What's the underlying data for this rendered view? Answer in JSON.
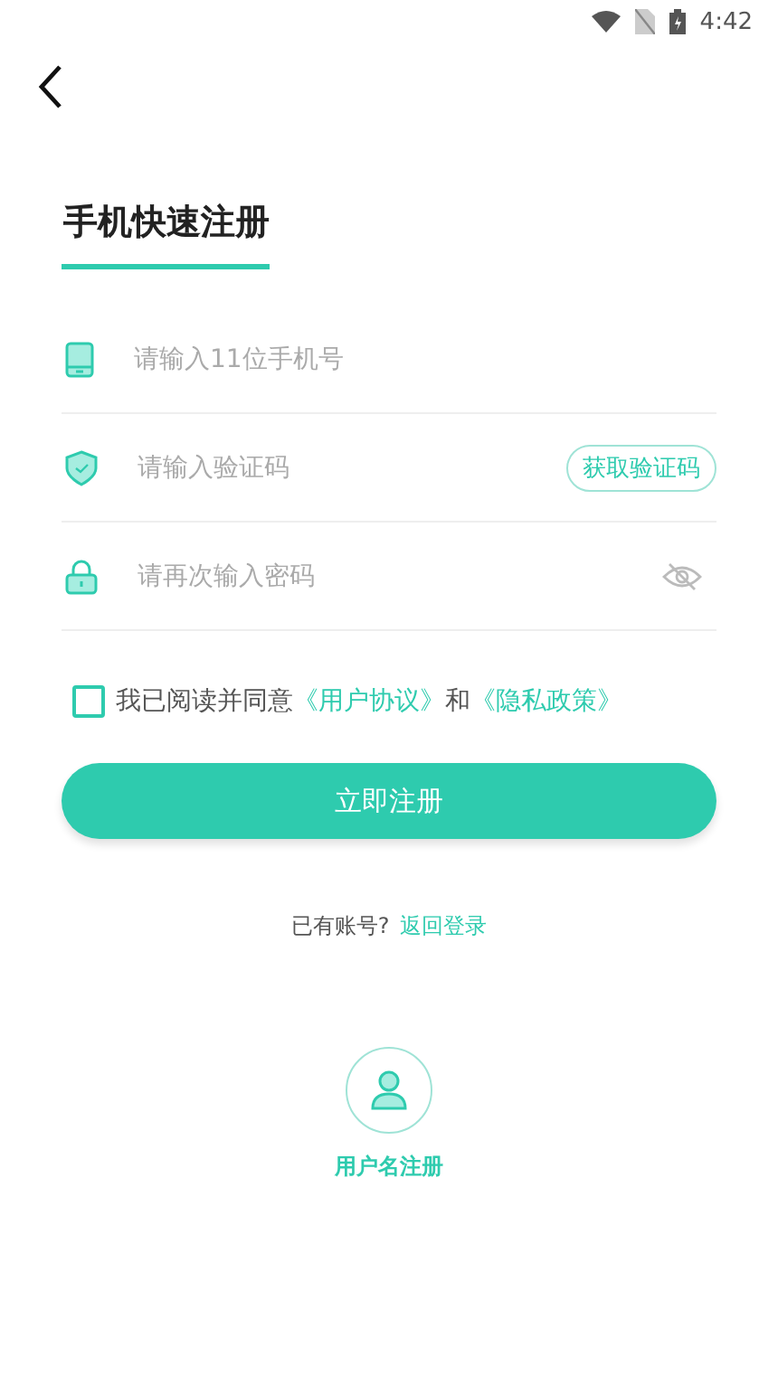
{
  "status_bar": {
    "time": "4:42"
  },
  "title": "手机快速注册",
  "fields": [
    {
      "kind": "phone",
      "placeholder": "请输入11位手机号"
    },
    {
      "kind": "code",
      "placeholder": "请输入验证码",
      "action": "获取验证码"
    },
    {
      "kind": "password",
      "placeholder": "请再次输入密码"
    }
  ],
  "agreement": {
    "checked": false,
    "prefix": "我已阅读并同意",
    "link_1": "《用户协议》",
    "joiner": "和",
    "link_2": "《隐私政策》"
  },
  "submit": "立即注册",
  "login": {
    "question": "已有账号?",
    "link": "返回登录"
  },
  "alt_register": {
    "label": "用户名注册"
  }
}
